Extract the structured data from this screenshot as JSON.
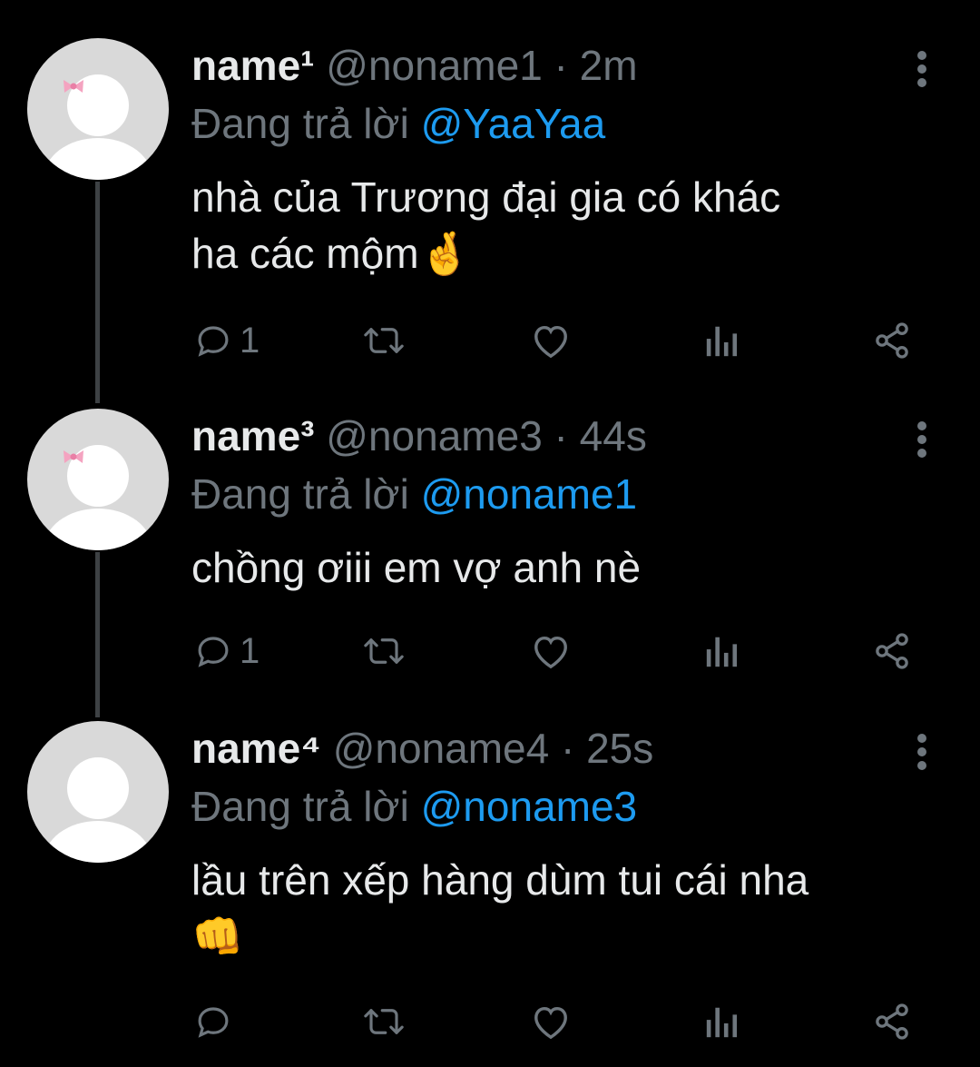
{
  "colors": {
    "background": "#000000",
    "primary_text": "#e7e9ea",
    "secondary_text": "#6e767d",
    "mention": "#1d9bf0",
    "thread_line": "#3d4144"
  },
  "tweets": [
    {
      "display_name": "name¹",
      "meta": "@noname1 · 2m",
      "reply_prefix": "Đang trả lời",
      "reply_to": "@YaaYaa",
      "text_line1": "nhà của Trương đại gia có khác",
      "text_line2": "ha các mộm",
      "emoji": "🤞",
      "reply_count": "1",
      "avatar_icon": "default-avatar-with-bow-icon"
    },
    {
      "display_name": "name³",
      "meta": "@noname3 · 44s",
      "reply_prefix": "Đang trả lời",
      "reply_to": "@noname1",
      "text_line1": "chồng ơiii em vợ anh nè",
      "reply_count": "1",
      "avatar_icon": "default-avatar-with-bow-icon"
    },
    {
      "display_name": "name⁴",
      "meta": "@noname4 · 25s",
      "reply_prefix": "Đang trả lời",
      "reply_to": "@noname3",
      "text_line1": "lầu trên xếp hàng dùm tui cái nha",
      "emoji": "👊",
      "reply_count": "",
      "avatar_icon": "default-avatar-icon"
    }
  ],
  "action_icons": [
    "reply-icon",
    "retweet-icon",
    "like-icon",
    "analytics-icon",
    "share-icon"
  ]
}
